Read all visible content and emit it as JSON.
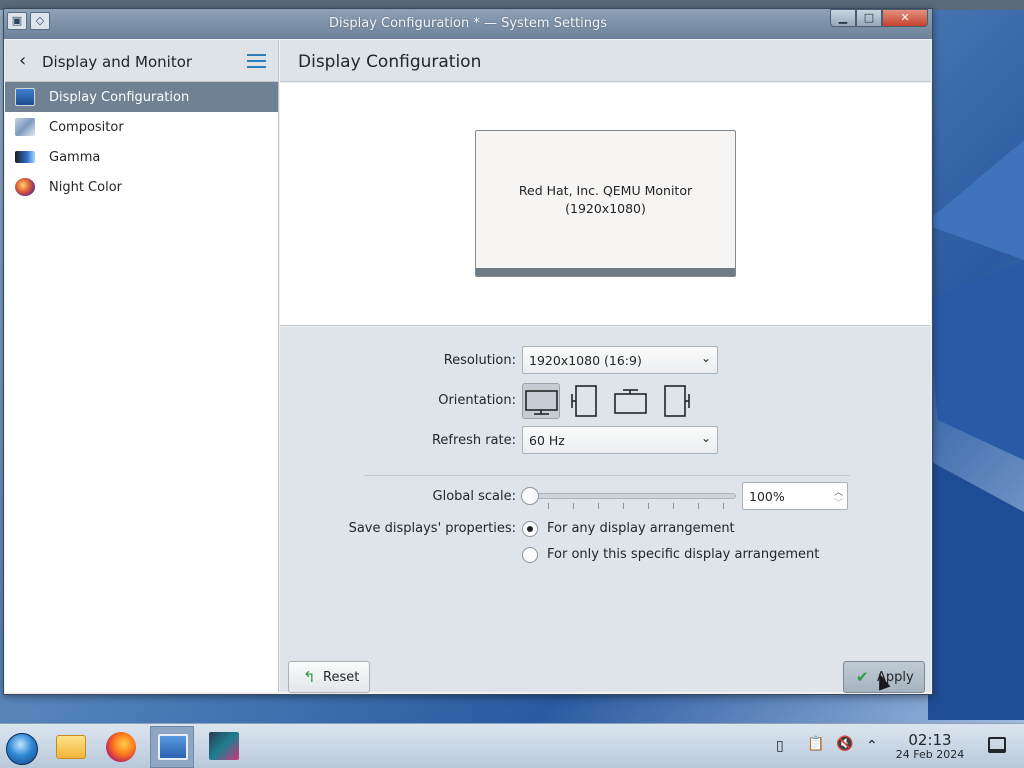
{
  "window": {
    "title": "Display Configuration * — System Settings",
    "buttons": {
      "minimize": "▁",
      "maximize": "□",
      "close": "✕"
    }
  },
  "sidebar": {
    "back_icon": "‹",
    "title": "Display and Monitor",
    "items": [
      {
        "label": "Display Configuration",
        "icon": "display-icon",
        "active": true
      },
      {
        "label": "Compositor",
        "icon": "compositor-icon",
        "active": false
      },
      {
        "label": "Gamma",
        "icon": "gamma-icon",
        "active": false
      },
      {
        "label": "Night Color",
        "icon": "night-color-icon",
        "active": false
      }
    ]
  },
  "main": {
    "title": "Display Configuration",
    "monitor": {
      "name": "Red Hat, Inc. QEMU Monitor",
      "resolution": "(1920x1080)"
    },
    "resolution": {
      "label": "Resolution:",
      "value": "1920x1080 (16:9)",
      "chevron": "⌄"
    },
    "orientation": {
      "label": "Orientation:",
      "options": [
        {
          "name": "landscape",
          "selected": true
        },
        {
          "name": "portrait-left",
          "selected": false
        },
        {
          "name": "landscape-flipped",
          "selected": false
        },
        {
          "name": "portrait-right",
          "selected": false
        }
      ]
    },
    "refresh_rate": {
      "label": "Refresh rate:",
      "value": "60 Hz",
      "chevron": "⌄"
    },
    "global_scale": {
      "label": "Global scale:",
      "value": "100%",
      "level": 0.0,
      "spin_up": "︿",
      "spin_down": "﹀"
    },
    "save_properties": {
      "label": "Save displays' properties:",
      "options": [
        {
          "label": "For any display arrangement",
          "checked": true
        },
        {
          "label": "For only this specific display arrangement",
          "checked": false
        }
      ]
    },
    "buttons": {
      "reset": "Reset",
      "reset_icon": "↰",
      "apply": "Apply",
      "apply_icon": "✔"
    }
  },
  "taskbar": {
    "apps": [
      "start-menu",
      "file-manager",
      "firefox",
      "system-settings",
      "system-monitor"
    ],
    "clock": {
      "time": "02:13",
      "date": "24 Feb 2024"
    },
    "tray": {
      "clipboard_icon": "📋",
      "volume_icon": "🔇",
      "expand_icon": "⌃"
    }
  },
  "colors": {
    "accent": "#2f7fb8",
    "active_item": "#6f8193",
    "titlebar": "#7e93aa"
  }
}
